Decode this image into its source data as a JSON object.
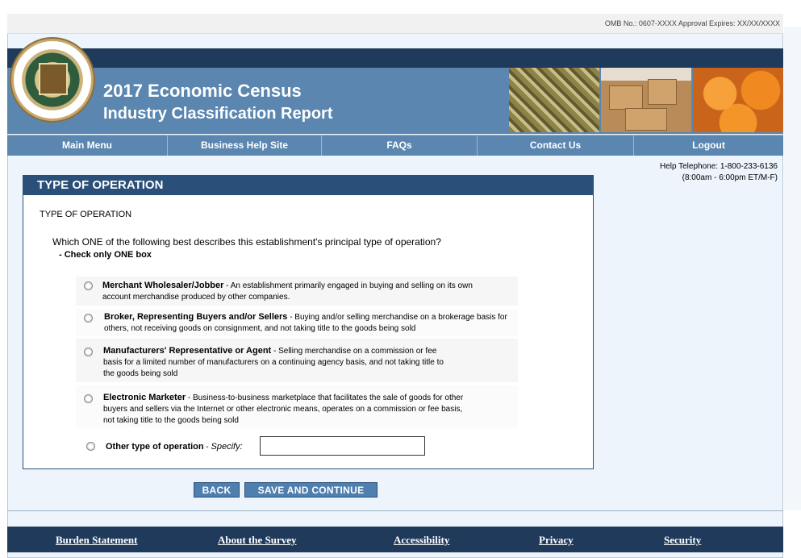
{
  "omb": "OMB No.: 0607-XXXX Approval Expires: XX/XX/XXXX",
  "banner": {
    "title_line1": "2017 Economic Census",
    "title_line2": "Industry Classification Report"
  },
  "nav": [
    "Main Menu",
    "Business Help Site",
    "FAQs",
    "Contact Us",
    "Logout"
  ],
  "help": {
    "line1": "Help Telephone: 1-800-233-6136",
    "line2": "(8:00am - 6:00pm ET/M-F)"
  },
  "panel": {
    "header": "TYPE OF OPERATION",
    "subtitle": "TYPE OF OPERATION",
    "question": "Which ONE of the following best describes this establishment's principal type of operation?",
    "check_note": "- Check only ONE box"
  },
  "options": [
    {
      "label": "Merchant Wholesaler/Jobber",
      "line1": " - An establishment primarily engaged in buying and selling on its own",
      "line2": "account merchandise produced by other companies."
    },
    {
      "label": "Broker, Representing Buyers and/or Sellers",
      "line1": " -  Buying and/or selling merchandise on a brokerage basis for",
      "line2": "others, not receiving goods on consignment, and not taking title to the goods being sold"
    },
    {
      "label": "Manufacturers' Representative or Agent",
      "line1": " -  Selling merchandise on a commission or fee",
      "line2": "basis for a limited number of manufacturers on a continuing agency basis,  and not taking title to",
      "line3": "the goods being sold"
    },
    {
      "label": "Electronic Marketer",
      "line1": " -  Business-to-business marketplace that facilitates the sale of goods for other",
      "line2": "buyers and sellers via the Internet or other electronic means,  operates on a commission or fee basis,",
      "line3": "not taking title to the goods being sold"
    },
    {
      "label": "Other type of operation",
      "dash": " - ",
      "specify": "Specify:",
      "specify_value": ""
    }
  ],
  "buttons": {
    "back": "BACK",
    "save": "SAVE AND CONTINUE"
  },
  "footer": [
    "Burden Statement",
    "About the Survey",
    "Accessibility",
    "Privacy",
    "Security"
  ]
}
